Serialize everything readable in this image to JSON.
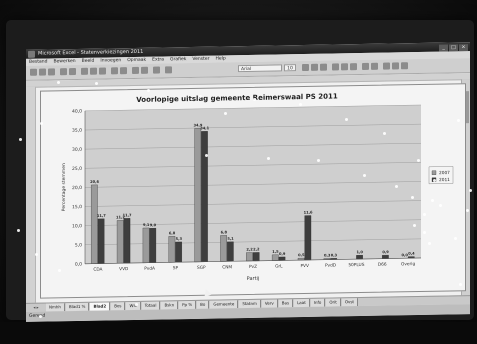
{
  "window": {
    "title": "Microsoft Excel - Statenverkiezingen 2011"
  },
  "menu": [
    "Bestand",
    "Bewerken",
    "Beeld",
    "Invoegen",
    "Opmaak",
    "Extra",
    "Grafiek",
    "Venster",
    "Help"
  ],
  "toolbar": {
    "font": "Arial",
    "size": "10"
  },
  "tabs": [
    "Nmhh",
    "Blad1 %",
    "Blad2",
    "Bos",
    "Wsl",
    "Totaal",
    "Bskn",
    "Pp %",
    "Bo",
    "Gemeente",
    "Statnm",
    "Verv",
    "Bas",
    "Laat",
    "Info",
    "Orit",
    "Ovst"
  ],
  "active_tab_index": 2,
  "status_text": "Gereed",
  "chart_data": {
    "type": "bar",
    "title": "Voorlopige uitslag gemeente Reimerswaal PS 2011",
    "xlabel": "Partij",
    "ylabel": "Percentage stemmen",
    "ylim": [
      0,
      40
    ],
    "yticks": [
      "0,0",
      "5,0",
      "10,0",
      "15,0",
      "20,0",
      "25,0",
      "30,0",
      "35,0",
      "40,0"
    ],
    "categories": [
      "CDA",
      "VVD",
      "PvdA",
      "SP",
      "SGP",
      "CNM",
      "PvZ",
      "GrL",
      "PVV",
      "PvdD",
      "50PLUS",
      "D66",
      "Overig"
    ],
    "series": [
      {
        "name": "2007",
        "color": "#9a9a9a",
        "values": [
          20.6,
          11.2,
          9.1,
          6.8,
          34.9,
          6.8,
          2.2,
          1.5,
          0.5,
          0.3,
          0.0,
          0.0,
          0.0
        ],
        "labels": [
          "20,6",
          "11,2",
          "9,1",
          "6,8",
          "34,9",
          "6,8",
          "2,2",
          "1,5",
          "0,5",
          "0,3",
          "",
          "",
          "0,0"
        ]
      },
      {
        "name": "2011",
        "color": "#3e3e3e",
        "values": [
          11.7,
          11.7,
          9.0,
          5.3,
          34.1,
          5.1,
          2.2,
          0.9,
          11.6,
          0.3,
          1.0,
          0.9,
          0.4
        ],
        "labels": [
          "11,7",
          "11,7",
          "9,0",
          "5,3",
          "34,1",
          "5,1",
          "2,2",
          "0,9",
          "11,6",
          "0,3",
          "1,0",
          "0,9",
          "0,4"
        ]
      }
    ],
    "legend_position": "right",
    "grid": true
  }
}
